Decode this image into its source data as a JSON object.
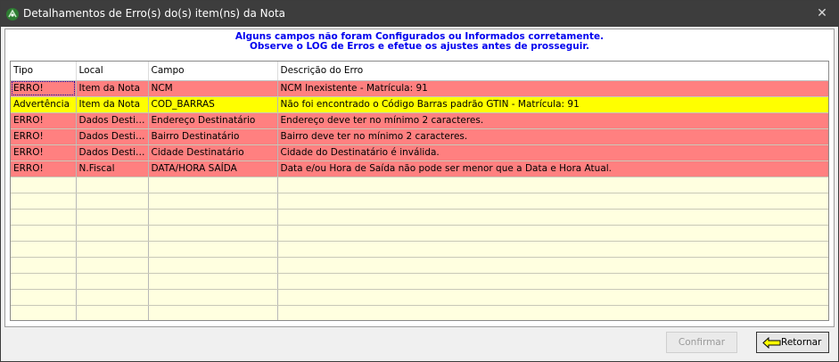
{
  "window": {
    "title": "Detalhamentos de Erro(s) do(s) item(ns) da Nota",
    "close_glyph": "✕"
  },
  "message": {
    "line1": "Alguns campos não foram Configurados ou Informados corretamente.",
    "line2": "Observe o LOG de Erros e efetue os ajustes antes de prosseguir."
  },
  "table": {
    "columns": [
      "Tipo",
      "Local",
      "Campo",
      "Descrição do Erro"
    ],
    "rows": [
      {
        "tipo": "ERRO!",
        "local": "Item da Nota",
        "campo": "NCM",
        "descricao": "NCM Inexistente - Matrícula: 91",
        "kind": "erro"
      },
      {
        "tipo": "Advertência",
        "local": "Item da Nota",
        "campo": "COD_BARRAS",
        "descricao": "Não foi encontrado o Código Barras padrão GTIN - Matrícula: 91",
        "kind": "adv"
      },
      {
        "tipo": "ERRO!",
        "local": "Dados Destin...",
        "campo": "Endereço Destinatário",
        "descricao": "Endereço deve ter no mínimo 2 caracteres.",
        "kind": "erro"
      },
      {
        "tipo": "ERRO!",
        "local": "Dados Destin...",
        "campo": "Bairro Destinatário",
        "descricao": "Bairro deve ter no mínimo 2 caracteres.",
        "kind": "erro"
      },
      {
        "tipo": "ERRO!",
        "local": "Dados Destin...",
        "campo": "Cidade Destinatário",
        "descricao": "Cidade do Destinatário é inválida.",
        "kind": "erro"
      },
      {
        "tipo": "ERRO!",
        "local": "N.Fiscal",
        "campo": "DATA/HORA SAÍDA",
        "descricao": "Data e/ou Hora de Saída não pode ser menor que a Data e Hora Atual.",
        "kind": "erro"
      }
    ]
  },
  "buttons": {
    "confirm_label": "Confirmar",
    "return_label": "Retornar"
  },
  "colors": {
    "error_row": "#ff8080",
    "warning_row": "#ffff00",
    "empty_row": "#ffffe0",
    "message_text": "#0000ee",
    "titlebar": "#3d3d3d"
  }
}
